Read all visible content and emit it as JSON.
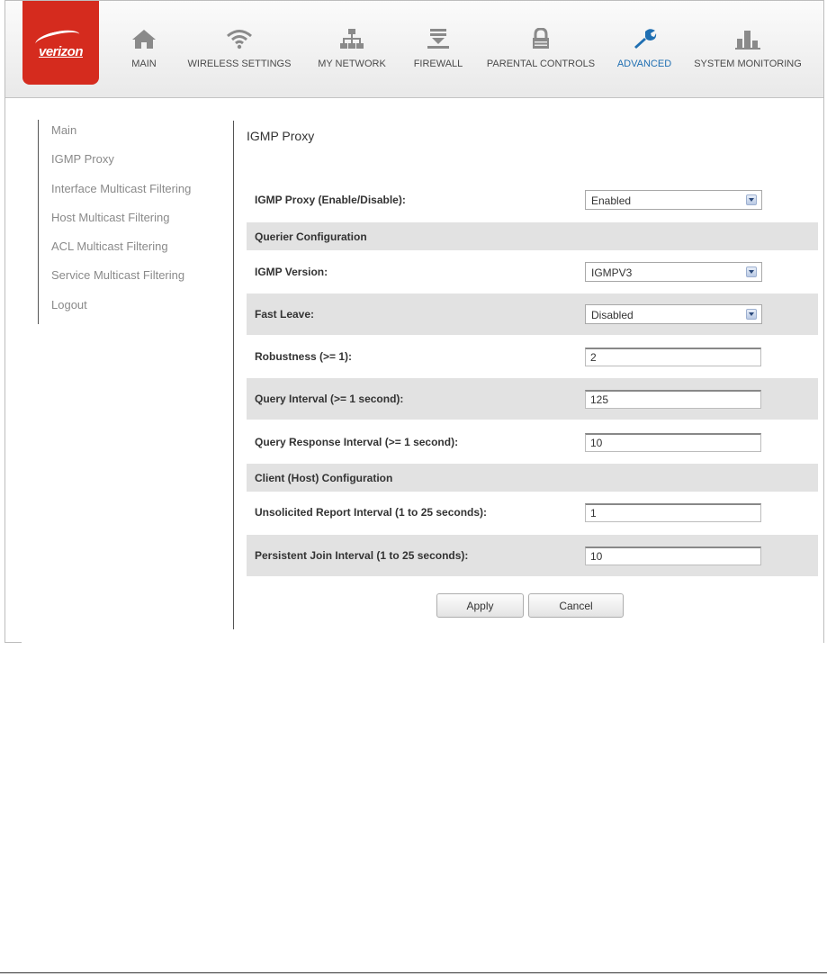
{
  "brand": {
    "logo_text": "verizon",
    "color": "#d52b1e"
  },
  "nav": [
    {
      "id": "main",
      "label": "MAIN",
      "icon": "home-icon"
    },
    {
      "id": "wireless",
      "label": "WIRELESS SETTINGS",
      "icon": "wifi-icon"
    },
    {
      "id": "network",
      "label": "MY NETWORK",
      "icon": "network-icon"
    },
    {
      "id": "firewall",
      "label": "FIREWALL",
      "icon": "firewall-icon"
    },
    {
      "id": "parental",
      "label": "PARENTAL CONTROLS",
      "icon": "lock-icon"
    },
    {
      "id": "advanced",
      "label": "ADVANCED",
      "icon": "wrench-icon",
      "active": true
    },
    {
      "id": "monitoring",
      "label": "SYSTEM MONITORING",
      "icon": "bar-chart-icon"
    }
  ],
  "sidebar": {
    "items": [
      {
        "label": "Main"
      },
      {
        "label": "IGMP Proxy"
      },
      {
        "label": "Interface Multicast Filtering"
      },
      {
        "label": "Host Multicast Filtering"
      },
      {
        "label": "ACL Multicast Filtering"
      },
      {
        "label": "Service Multicast Filtering"
      },
      {
        "label": "Logout"
      }
    ]
  },
  "page": {
    "title": "IGMP Proxy"
  },
  "form": {
    "proxy": {
      "label": "IGMP Proxy (Enable/Disable):",
      "value": "Enabled"
    },
    "querier_section": "Querier Configuration",
    "version": {
      "label": "IGMP Version:",
      "value": "IGMPV3"
    },
    "fast_leave": {
      "label": "Fast Leave:",
      "value": "Disabled"
    },
    "robustness": {
      "label": "Robustness (>= 1):",
      "value": "2"
    },
    "query_interval": {
      "label": "Query Interval (>= 1 second):",
      "value": "125"
    },
    "query_response": {
      "label": "Query Response Interval (>= 1 second):",
      "value": "10"
    },
    "client_section": "Client (Host) Configuration",
    "unsolicited": {
      "label": "Unsolicited Report Interval (1 to 25 seconds):",
      "value": "1"
    },
    "persistent": {
      "label": "Persistent Join Interval (1 to 25 seconds):",
      "value": "10"
    }
  },
  "buttons": {
    "apply": "Apply",
    "cancel": "Cancel"
  }
}
